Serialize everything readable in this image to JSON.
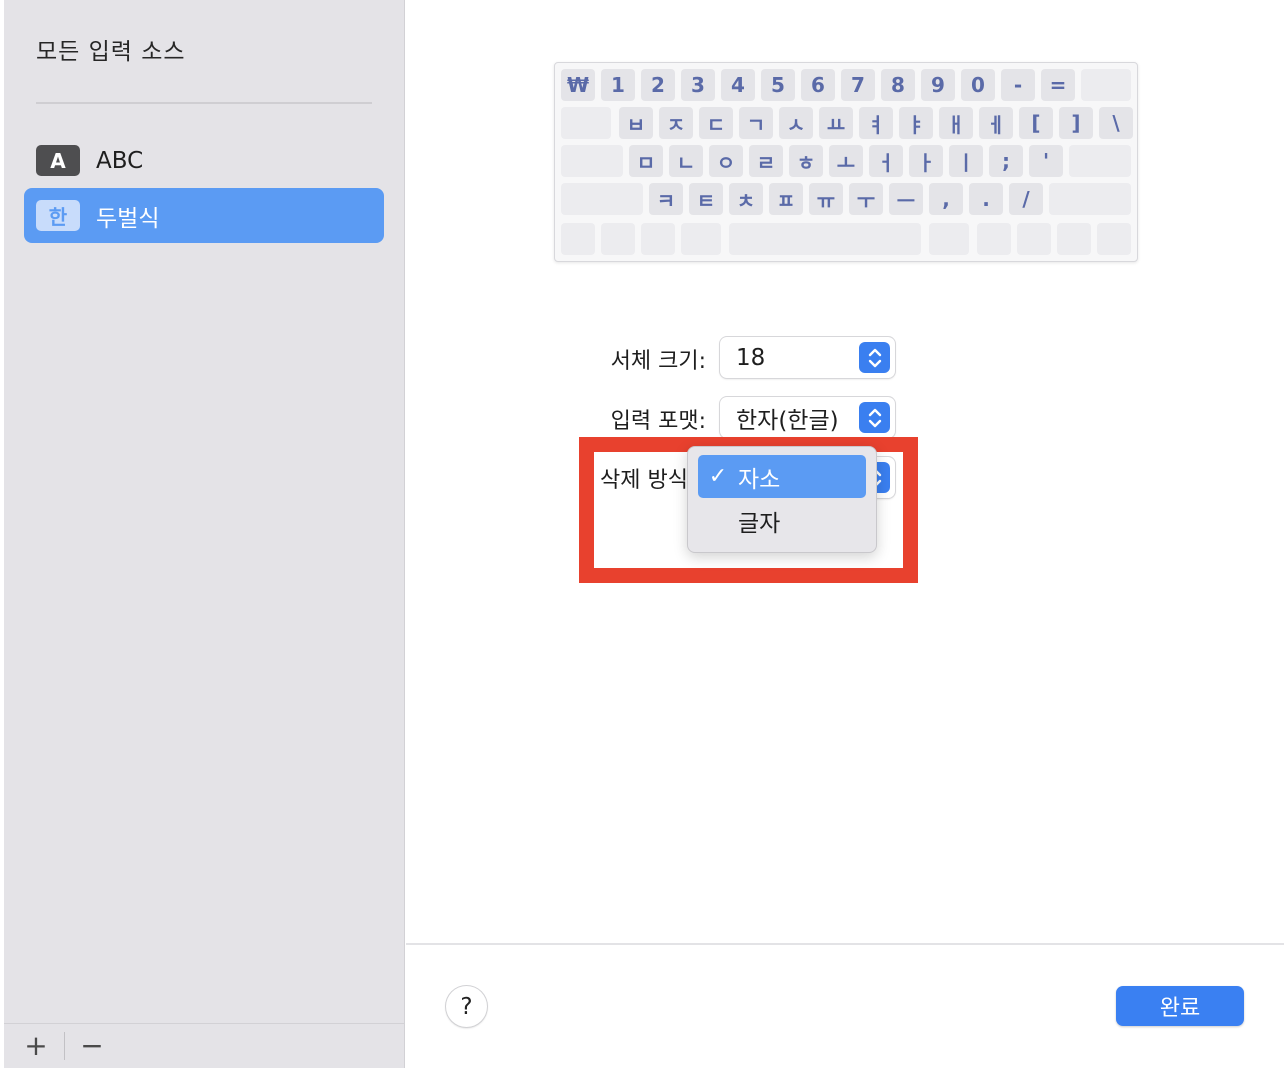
{
  "sidebar": {
    "title": "모든 입력 소스",
    "items": [
      {
        "badge": "A",
        "label": "ABC",
        "selected": false
      },
      {
        "badge": "한",
        "label": "두벌식",
        "selected": true
      }
    ],
    "add_label": "+",
    "remove_label": "−"
  },
  "keyboard": {
    "rows": [
      [
        "₩",
        "1",
        "2",
        "3",
        "4",
        "5",
        "6",
        "7",
        "8",
        "9",
        "0",
        "-",
        "="
      ],
      [
        "ㅂ",
        "ㅈ",
        "ㄷ",
        "ㄱ",
        "ㅅ",
        "ㅛ",
        "ㅕ",
        "ㅑ",
        "ㅐ",
        "ㅔ",
        "[",
        "]",
        "\\"
      ],
      [
        "ㅁ",
        "ㄴ",
        "ㅇ",
        "ㄹ",
        "ㅎ",
        "ㅗ",
        "ㅓ",
        "ㅏ",
        "ㅣ",
        ";",
        "'"
      ],
      [
        "ㅋ",
        "ㅌ",
        "ㅊ",
        "ㅍ",
        "ㅠ",
        "ㅜ",
        "ㅡ",
        ",",
        ".",
        "/"
      ]
    ]
  },
  "settings": {
    "font_size": {
      "label": "서체 크기:",
      "value": "18"
    },
    "input_format": {
      "label": "입력 포맷:",
      "value": "한자(한글)"
    },
    "delete_mode": {
      "label": "삭제 방식",
      "options": [
        "자소",
        "글자"
      ],
      "selected": "자소"
    }
  },
  "footer": {
    "help_label": "?",
    "done_label": "완료"
  },
  "colors": {
    "accent": "#3a80f2",
    "selection": "#5b9bf3",
    "highlight": "#e8412e"
  }
}
